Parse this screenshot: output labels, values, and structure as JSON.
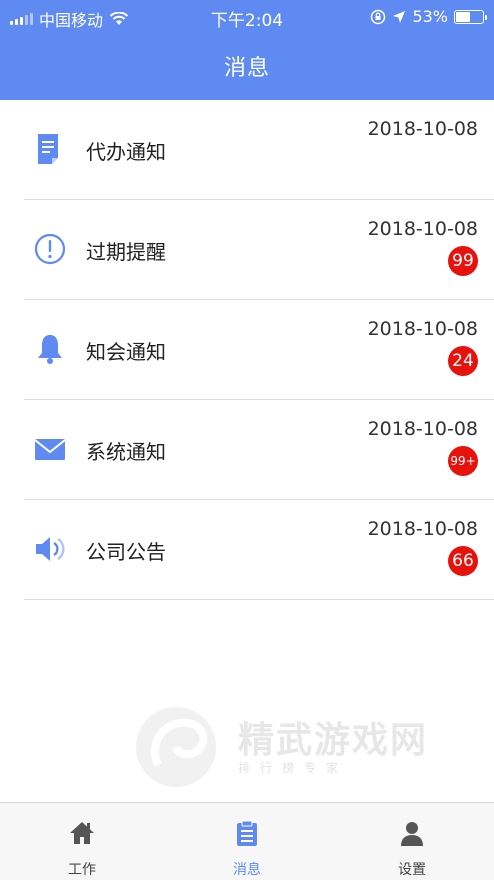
{
  "status_bar": {
    "carrier": "中国移动",
    "time": "下午2:04",
    "battery_percent": "53%",
    "battery_level": 0.53
  },
  "header": {
    "title": "消息"
  },
  "colors": {
    "accent": "#5f8af2",
    "badge": "#e8120c"
  },
  "messages": [
    {
      "label": "代办通知",
      "date": "2018-10-08",
      "badge": "",
      "icon": "document-icon"
    },
    {
      "label": "过期提醒",
      "date": "2018-10-08",
      "badge": "99",
      "icon": "alert-circle-icon"
    },
    {
      "label": "知会通知",
      "date": "2018-10-08",
      "badge": "24",
      "icon": "bell-icon"
    },
    {
      "label": "系统通知",
      "date": "2018-10-08",
      "badge": "99+",
      "icon": "mail-icon"
    },
    {
      "label": "公司公告",
      "date": "2018-10-08",
      "badge": "66",
      "icon": "speaker-icon"
    }
  ],
  "watermark": {
    "title": "精武游戏网",
    "subtitle": "排行榜专家"
  },
  "tabbar": {
    "tabs": [
      {
        "label": "工作",
        "icon": "home-icon"
      },
      {
        "label": "消息",
        "icon": "clipboard-icon",
        "active": true
      },
      {
        "label": "设置",
        "icon": "user-icon"
      }
    ]
  }
}
